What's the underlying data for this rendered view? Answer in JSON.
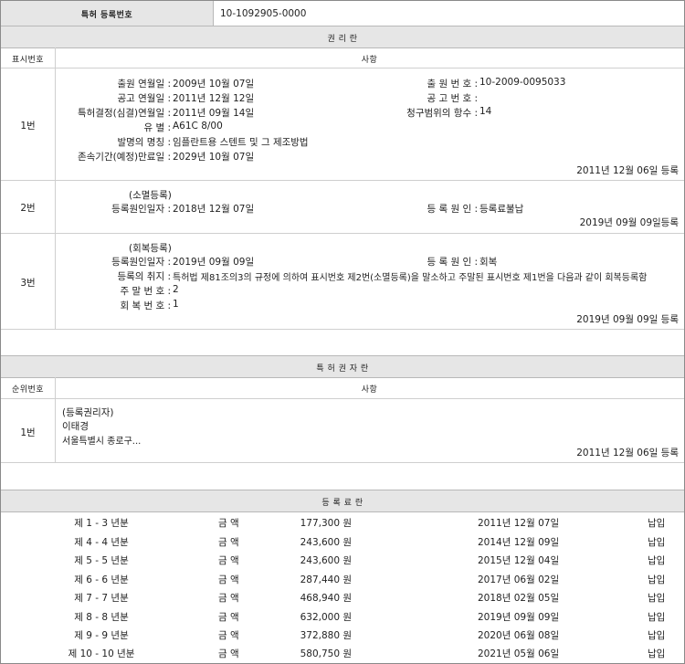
{
  "patent": {
    "label": "특허 등록번호",
    "value": "10-1092905-0000"
  },
  "rights": {
    "title": "권 리 란",
    "col_no": "표시번호",
    "col_matter": "사항",
    "entry1": {
      "no": "1번",
      "left": [
        {
          "label": "출원 연월일 :",
          "value": "2009년 10월 07일"
        },
        {
          "label": "공고 연월일 :",
          "value": "2011년 12월 12일"
        },
        {
          "label": "특허결정(심결)연월일 :",
          "value": "2011년 09월 14일"
        },
        {
          "label": "유 별 :",
          "value": "A61C 8/00"
        },
        {
          "label": "발명의 명칭 :",
          "value": "임플란트용 스텐트 및 그 제조방법"
        },
        {
          "label": "존속기간(예정)만료일 :",
          "value": "2029년 10월 07일"
        }
      ],
      "right": [
        {
          "label": "출 원 번 호 :",
          "value": "10-2009-0095033"
        },
        {
          "label": "공 고 번 호 :",
          "value": ""
        },
        {
          "label": "청구범위의 항수 :",
          "value": "14"
        }
      ],
      "reg": "2011년 12월 06일 등록"
    },
    "entry2": {
      "no": "2번",
      "heading": "(소멸등록)",
      "date_label": "등록원인일자 :",
      "date_value": "2018년 12월 07일",
      "cause_label": "등 록 원 인 :",
      "cause_value": "등록료불납",
      "reg": "2019년 09월 09일등록"
    },
    "entry3": {
      "no": "3번",
      "heading": "(회복등록)",
      "date_label": "등록원인일자 :",
      "date_value": "2019년 09월 09일",
      "cause_label": "등 록 원 인 :",
      "cause_value": "회복",
      "purpose_label": "등록의 취지 :",
      "purpose_value": "특허법 제81조의3의 규정에 의하여 표시번호 제2번(소멸등록)을 말소하고 주말된 표시번호 제1번을 다음과 같이 회복등록함",
      "strike_label": "주 말 번 호 :",
      "strike_value": "2",
      "recover_label": "회 복 번 호 :",
      "recover_value": "1",
      "reg": "2019년 09월 09일 등록"
    }
  },
  "owner": {
    "title": "특 허 권 자 란",
    "col_no": "순위번호",
    "col_matter": "사항",
    "entry": {
      "no": "1번",
      "heading": "(등록권리자)",
      "name": "이태경",
      "address": "서울특별시 종로구...",
      "reg": "2011년 12월 06일 등록"
    }
  },
  "fees": {
    "title": "등 록 료 란",
    "amount_label": "금 액",
    "rows": [
      {
        "year": "제 1 - 3 년분",
        "amount": "177,300 원",
        "date": "2011년 12월 07일",
        "status": "납입"
      },
      {
        "year": "제 4 - 4 년분",
        "amount": "243,600 원",
        "date": "2014년 12월 09일",
        "status": "납입"
      },
      {
        "year": "제 5 - 5 년분",
        "amount": "243,600 원",
        "date": "2015년 12월 04일",
        "status": "납입"
      },
      {
        "year": "제 6 - 6 년분",
        "amount": "287,440 원",
        "date": "2017년 06월 02일",
        "status": "납입"
      },
      {
        "year": "제 7 - 7 년분",
        "amount": "468,940 원",
        "date": "2018년 02월 05일",
        "status": "납입"
      },
      {
        "year": "제 8 - 8 년분",
        "amount": "632,000 원",
        "date": "2019년 09월 09일",
        "status": "납입"
      },
      {
        "year": "제 9 - 9 년분",
        "amount": "372,880 원",
        "date": "2020년 06월 08일",
        "status": "납입"
      },
      {
        "year": "제 10 - 10 년분",
        "amount": "580,750 원",
        "date": "2021년 05월 06일",
        "status": "납입"
      }
    ]
  }
}
